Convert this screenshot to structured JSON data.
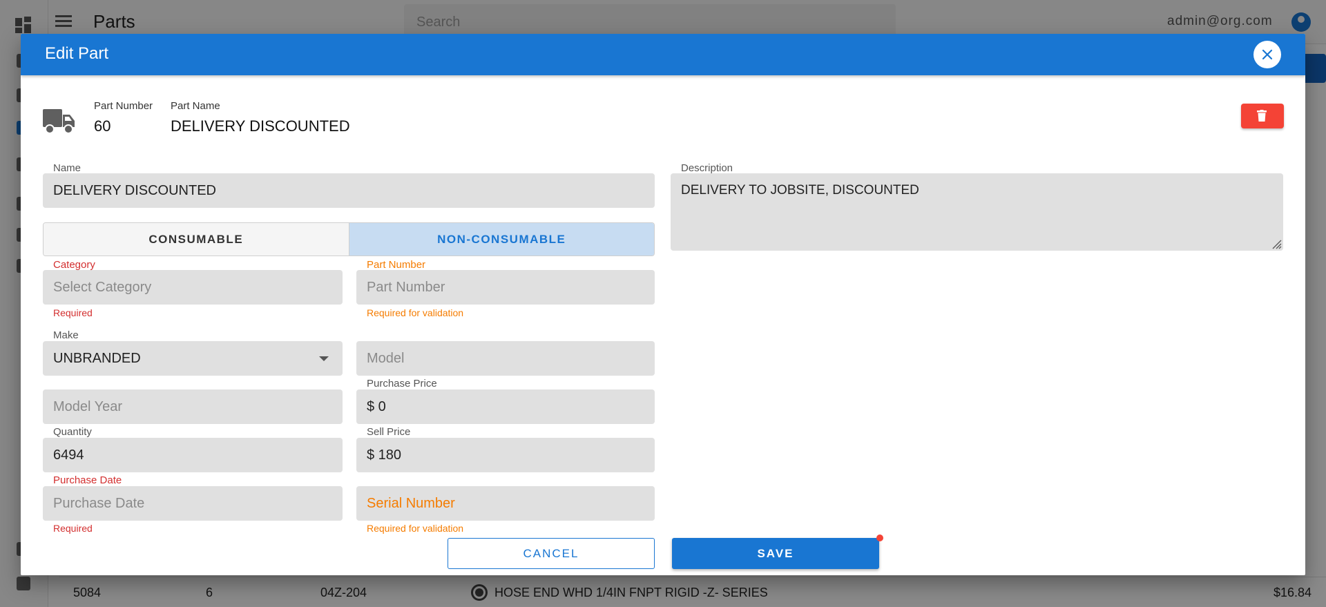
{
  "background": {
    "page_title": "Parts",
    "search_placeholder": "Search",
    "user_email": "admin@org.com",
    "row": {
      "id": "5084",
      "qty": "6",
      "part_number": "04Z-204",
      "name": "HOSE END WHD 1/4IN FNPT RIGID -Z- SERIES",
      "price": "$16.84"
    }
  },
  "dialog": {
    "title": "Edit Part",
    "header": {
      "part_number_label": "Part Number",
      "part_number_value": "60",
      "part_name_label": "Part Name",
      "part_name_value": "DELIVERY DISCOUNTED"
    },
    "form": {
      "name_label": "Name",
      "name_value": "DELIVERY DISCOUNTED",
      "description_label": "Description",
      "description_value": "DELIVERY TO JOBSITE, DISCOUNTED",
      "toggle_consumable": "CONSUMABLE",
      "toggle_non_consumable": "NON-CONSUMABLE",
      "toggle_selected": "NON-CONSUMABLE",
      "category_label": "Category",
      "category_placeholder": "Select Category",
      "category_helper": "Required",
      "part_number_label": "Part Number",
      "part_number_placeholder": "Part Number",
      "part_number_helper": "Required for validation",
      "make_label": "Make",
      "make_value": "UNBRANDED",
      "model_placeholder": "Model",
      "model_year_placeholder": "Model Year",
      "purchase_price_label": "Purchase Price",
      "purchase_price_value": "$ 0",
      "quantity_label": "Quantity",
      "quantity_value": "6494",
      "sell_price_label": "Sell Price",
      "sell_price_value": "$ 180",
      "purchase_date_label": "Purchase Date",
      "purchase_date_placeholder": "Purchase Date",
      "purchase_date_helper": "Required",
      "serial_number_placeholder": "Serial Number",
      "serial_number_helper": "Required for validation"
    },
    "buttons": {
      "cancel": "CANCEL",
      "save": "SAVE"
    }
  },
  "colors": {
    "primary": "#1976d2",
    "error": "#d32f2f",
    "warning": "#f57c00",
    "delete": "#f44336"
  },
  "icons": [
    "apps-icon",
    "menu-icon",
    "account-icon",
    "close-icon",
    "truck-icon",
    "trash-icon",
    "dropdown-arrow-icon",
    "resize-handle-icon"
  ]
}
